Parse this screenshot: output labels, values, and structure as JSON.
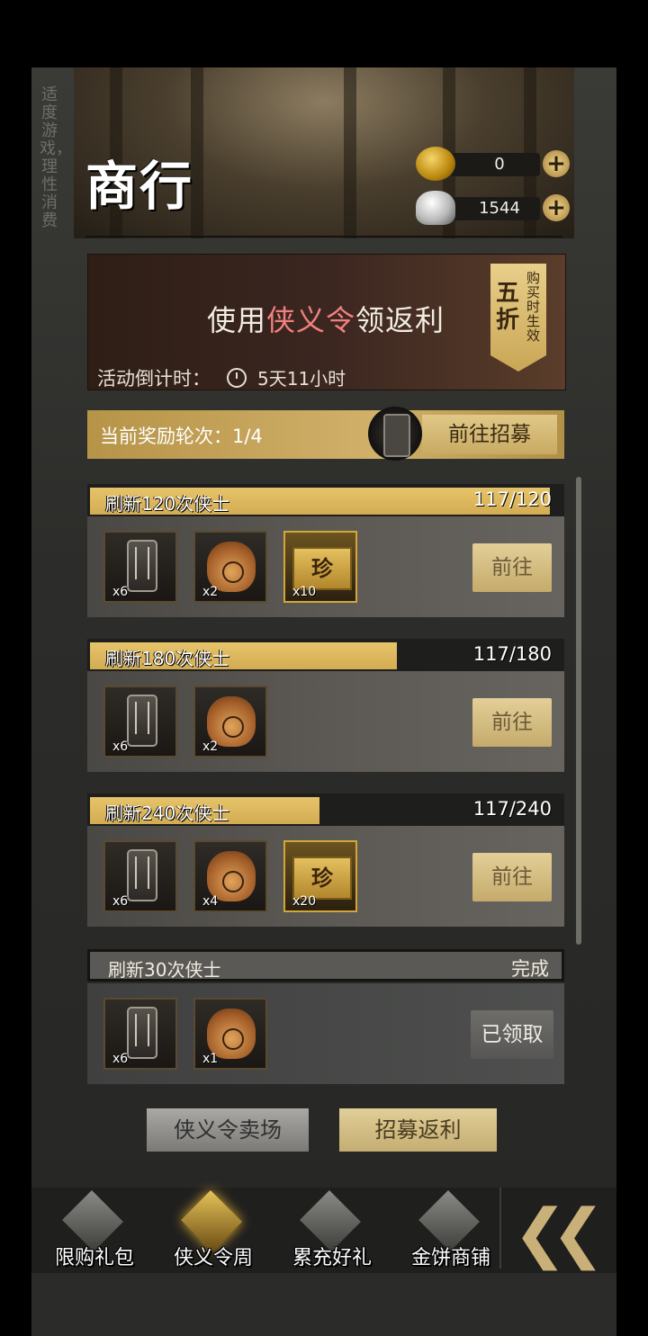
{
  "side_slogan": "适度游戏，理性消费",
  "header": {
    "logo": "商行",
    "gold_amount": "0",
    "silver_amount": "1544",
    "plus_label": "+"
  },
  "banner": {
    "title_prefix": "使用",
    "title_highlight": "侠义令",
    "title_suffix": "领返利",
    "countdown_label": "活动倒计时：",
    "countdown_time": "5天11小时",
    "discount_big": "五折",
    "discount_small": "购买时生效"
  },
  "round": {
    "label": "当前奖励轮次：1/4",
    "goto_label": "前往招募"
  },
  "tasks": [
    {
      "name": "刷新120次侠士",
      "count": "117/120",
      "progress": 0.975,
      "items": [
        {
          "type": "token",
          "qty": "x6"
        },
        {
          "type": "bag",
          "qty": "x2"
        },
        {
          "type": "ticket",
          "qty": "x10",
          "glyph": "珍"
        }
      ],
      "button": "前往"
    },
    {
      "name": "刷新180次侠士",
      "count": "117/180",
      "progress": 0.65,
      "items": [
        {
          "type": "token",
          "qty": "x6"
        },
        {
          "type": "bag",
          "qty": "x2"
        }
      ],
      "button": "前往"
    },
    {
      "name": "刷新240次侠士",
      "count": "117/240",
      "progress": 0.4875,
      "items": [
        {
          "type": "token",
          "qty": "x6"
        },
        {
          "type": "bag",
          "qty": "x4"
        },
        {
          "type": "ticket",
          "qty": "x20",
          "glyph": "珍"
        }
      ],
      "button": "前往"
    },
    {
      "name": "刷新30次侠士",
      "count": "完成",
      "progress": 1,
      "items": [
        {
          "type": "token",
          "qty": "x6"
        },
        {
          "type": "bag",
          "qty": "x1"
        }
      ],
      "button": "已领取"
    }
  ],
  "bottom_buttons": {
    "shop": "侠义令卖场",
    "rebate": "招募返利"
  },
  "nav": {
    "items": [
      "限购礼包",
      "侠义令周",
      "累充好礼",
      "金饼商铺"
    ],
    "active_index": 1,
    "collapse_glyph": "❮❮"
  },
  "colors": {
    "accent_gold": "#d3ac52",
    "highlight_red": "#f08080"
  }
}
